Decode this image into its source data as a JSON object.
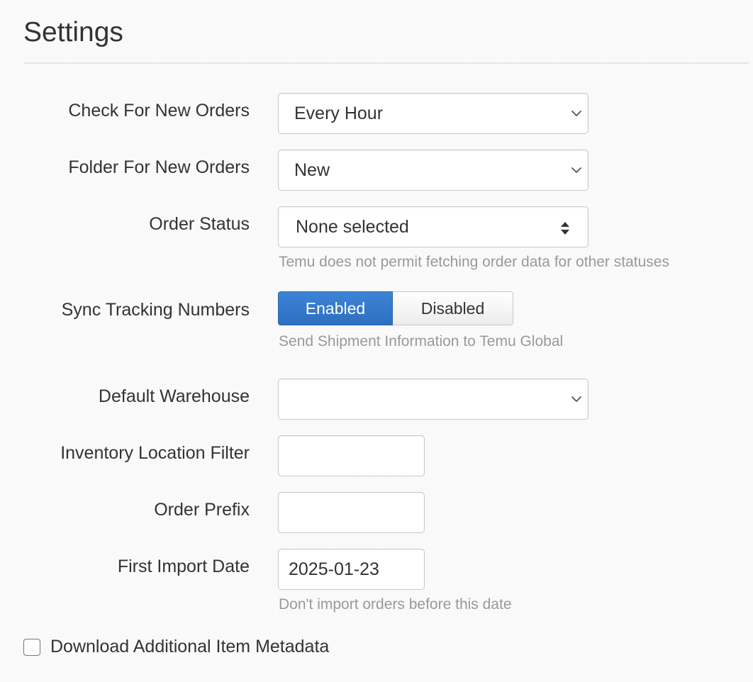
{
  "header": {
    "top_link_partial": "",
    "title": "Settings"
  },
  "form": {
    "check_orders": {
      "label": "Check For New Orders",
      "value": "Every Hour",
      "icon": "chevron-down-icon"
    },
    "folder": {
      "label": "Folder For New Orders",
      "value": "New",
      "icon": "chevron-down-icon"
    },
    "order_status": {
      "label": "Order Status",
      "value": "None selected",
      "help": "Temu does not permit fetching order data for other statuses",
      "icon": "sort-updown-icon"
    },
    "sync_tracking": {
      "label": "Sync Tracking Numbers",
      "enabled_label": "Enabled",
      "disabled_label": "Disabled",
      "selected": "Enabled",
      "help": "Send Shipment Information to Temu Global"
    },
    "warehouse": {
      "label": "Default Warehouse",
      "value": "",
      "icon": "chevron-down-icon"
    },
    "inventory_filter": {
      "label": "Inventory Location Filter",
      "value": ""
    },
    "order_prefix": {
      "label": "Order Prefix",
      "value": ""
    },
    "first_import": {
      "label": "First Import Date",
      "value": "2025-01-23",
      "help": "Don't import orders before this date"
    },
    "metadata": {
      "label": "Download Additional Item Metadata",
      "checked": false
    }
  },
  "colors": {
    "accent": "#2d6fc1",
    "link": "#2f7bd6",
    "help_text": "#999999",
    "border": "#c8c8c8"
  }
}
